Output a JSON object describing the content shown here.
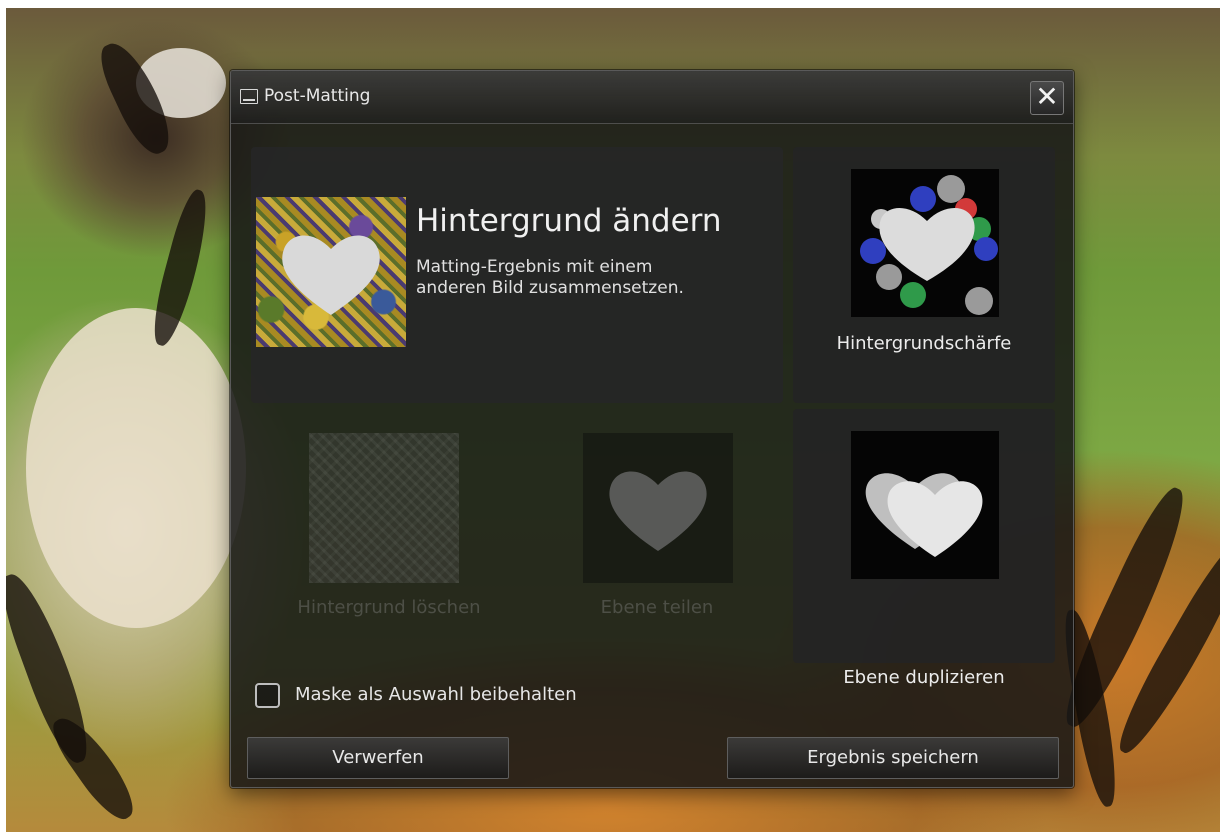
{
  "dialog": {
    "title": "Post-Matting",
    "close_glyph": "✕"
  },
  "tiles": {
    "change_background": {
      "title": "Hintergrund ändern",
      "description": "Matting-Ergebnis mit einem\n anderen Bild zusammensetzen."
    },
    "background_blur": {
      "label": "Hintergrundschärfe"
    },
    "delete_background": {
      "label": "Hintergrund löschen",
      "enabled": false
    },
    "split_layer": {
      "label": "Ebene teilen",
      "enabled": false
    },
    "duplicate_layer": {
      "label": "Ebene duplizieren"
    }
  },
  "options": {
    "keep_mask_label": "Maske als Auswahl beibehalten",
    "keep_mask_checked": false
  },
  "buttons": {
    "discard_label": "Verwerfen",
    "save_label": "Ergebnis speichern"
  },
  "icons": {
    "title": "window-icon",
    "close": "close-icon",
    "heart": "heart-icon"
  },
  "colors": {
    "heart": "#d9d9d9",
    "dialog_bg": "#161616",
    "bokeh": [
      "#2f3fbf",
      "#d23a3a",
      "#2f9a4a",
      "#9a9a9a"
    ]
  }
}
